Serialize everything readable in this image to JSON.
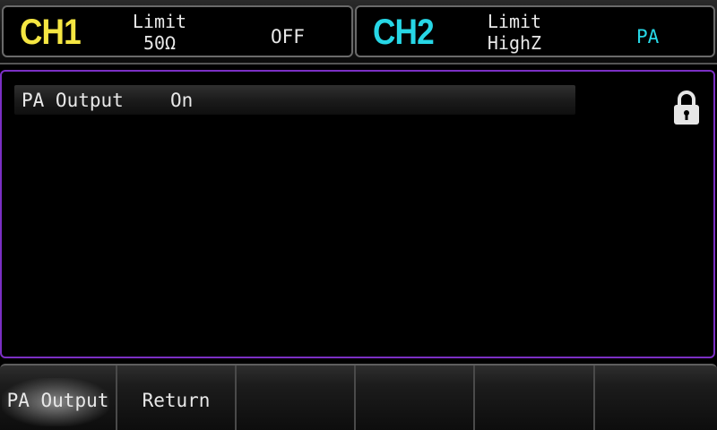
{
  "channels": [
    {
      "name": "CH1",
      "limit_label": "Limit",
      "limit_value": "50Ω",
      "state": "OFF",
      "color": "#f5e642"
    },
    {
      "name": "CH2",
      "limit_label": "Limit",
      "limit_value": "HighZ",
      "state": "PA",
      "color": "#27d7e6"
    }
  ],
  "panel": {
    "border_color": "#7b2fc4",
    "setting": {
      "label": "PA Output",
      "value": "On"
    },
    "lock_icon": "lock-icon"
  },
  "softkeys": [
    {
      "label": "PA Output",
      "active": true
    },
    {
      "label": "Return",
      "active": false
    },
    {
      "label": "",
      "active": false
    },
    {
      "label": "",
      "active": false
    },
    {
      "label": "",
      "active": false
    },
    {
      "label": "",
      "active": false
    }
  ]
}
